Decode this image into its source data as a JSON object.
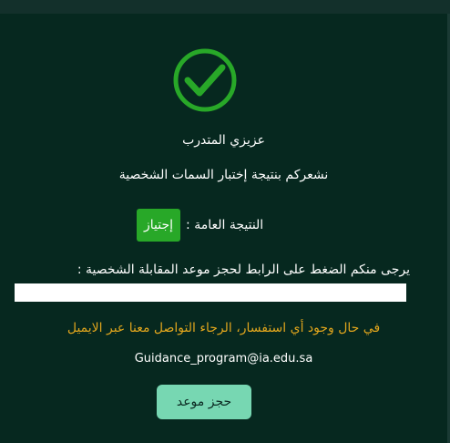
{
  "icons": {
    "success": "check-circle-icon"
  },
  "colors": {
    "background": "#06281f",
    "success_green": "#28a828",
    "accent_orange": "#e0a51d",
    "button_mint": "#77d7b2"
  },
  "message": {
    "greeting": "عزيزي المتدرب",
    "intro": "نشعركم بنتيجة إختبار السمات الشخصية",
    "result_label": "النتيجة العامة :",
    "result_value": "إجتياز",
    "link_prompt": "يرجى منكم الضغط على الرابط لحجز موعد المقابلة الشخصية :",
    "link_value": "",
    "contact_note": "في حال وجود أي استفسار، الرجاء التواصل معنا عبر الايميل",
    "email": "Guidance_program@ia.edu.sa"
  },
  "actions": {
    "book_label": "حجز موعد"
  }
}
